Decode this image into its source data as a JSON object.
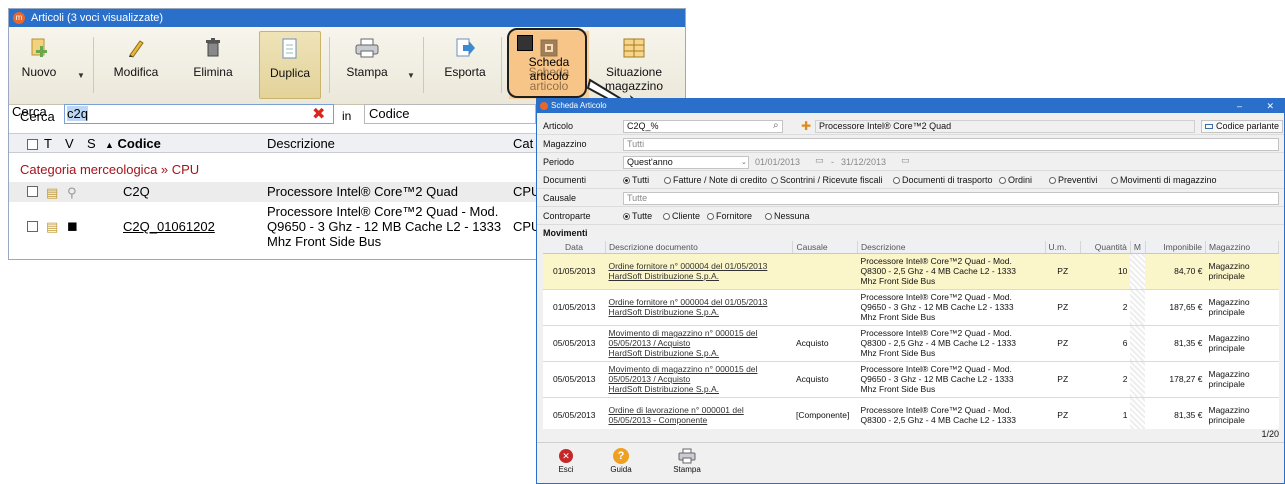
{
  "back_window": {
    "title": "Articoli (3 voci visualizzate)",
    "toolbar": {
      "nuovo": "Nuovo",
      "modifica": "Modifica",
      "elimina": "Elimina",
      "duplica": "Duplica",
      "stampa": "Stampa",
      "esporta": "Esporta",
      "scheda_line1": "Scheda",
      "scheda_line2": "articolo",
      "situazione_line1": "Situazione",
      "situazione_line2": "magazzino"
    },
    "search": {
      "label": "Cerca",
      "value": "c2q",
      "in_label": "in",
      "field": "Codice"
    },
    "columns": [
      "T",
      "V",
      "S",
      "Codice",
      "Descrizione",
      "Cat"
    ],
    "category": "Categoria merceologica » CPU",
    "rows": [
      {
        "codice": "C2Q",
        "descrizione": "Processore Intel® Core™2 Quad",
        "cat": "CPU"
      },
      {
        "codice": "C2Q_01061202",
        "desc1": "Processore Intel® Core™2 Quad - Mod.",
        "desc2": "Q9650 - 3 Ghz - 12 MB Cache L2 - 1333",
        "desc3": "Mhz Front Side Bus",
        "cat": "CPU"
      }
    ]
  },
  "front_window": {
    "title": "Scheda Articolo",
    "articolo_label": "Articolo",
    "articolo_value": "C2Q_%",
    "articolo_desc": "Processore Intel® Core™2 Quad",
    "codice_parlante": "Codice parlante",
    "magazzino_label": "Magazzino",
    "magazzino_value": "Tutti",
    "periodo_label": "Periodo",
    "periodo_value": "Quest'anno",
    "date_from": "01/01/2013",
    "date_sep": "-",
    "date_to": "31/12/2013",
    "documenti_label": "Documenti",
    "documenti_options": [
      "Tutti",
      "Fatture / Note di credito",
      "Scontrini / Ricevute fiscali",
      "Documenti di trasporto",
      "Ordini",
      "Preventivi",
      "Movimenti di magazzino"
    ],
    "causale_label": "Causale",
    "causale_value": "Tutte",
    "controparte_label": "Controparte",
    "controparte_options": [
      "Tutte",
      "Cliente",
      "Fornitore",
      "Nessuna"
    ],
    "movimenti_label": "Movimenti",
    "columns": [
      "Data",
      "Descrizione documento",
      "Causale",
      "Descrizione",
      "U.m.",
      "Quantità",
      "M",
      "Imponibile",
      "Magazzino"
    ],
    "rows": [
      {
        "data": "01/05/2013",
        "doc1": "Ordine fornitore n° 000004 del 01/05/2013",
        "doc2": "HardSoft Distribuzione S.p.A.",
        "doc3": "",
        "causale": "",
        "d1": "Processore Intel® Core™2 Quad - Mod.",
        "d2": "Q8300 - 2,5 Ghz - 4 MB Cache L2 - 1333",
        "d3": "Mhz Front Side Bus",
        "um": "PZ",
        "qta": "10",
        "imp": "84,70 €",
        "mag1": "Magazzino",
        "mag2": "principale"
      },
      {
        "data": "01/05/2013",
        "doc1": "Ordine fornitore n° 000004 del 01/05/2013",
        "doc2": "HardSoft Distribuzione S.p.A.",
        "doc3": "",
        "causale": "",
        "d1": "Processore Intel® Core™2 Quad - Mod.",
        "d2": "Q9650 - 3 Ghz - 12 MB Cache L2 - 1333",
        "d3": "Mhz Front Side Bus",
        "um": "PZ",
        "qta": "2",
        "imp": "187,65 €",
        "mag1": "Magazzino",
        "mag2": "principale"
      },
      {
        "data": "05/05/2013",
        "doc1": "Movimento di magazzino n° 000015 del",
        "doc2": "05/05/2013 / Acquisto",
        "doc3": "HardSoft Distribuzione S.p.A.",
        "causale": "Acquisto",
        "d1": "Processore Intel® Core™2 Quad - Mod.",
        "d2": "Q8300 - 2,5 Ghz - 4 MB Cache L2 - 1333",
        "d3": "Mhz Front Side Bus",
        "um": "PZ",
        "qta": "6",
        "imp": "81,35 €",
        "mag1": "Magazzino",
        "mag2": "principale"
      },
      {
        "data": "05/05/2013",
        "doc1": "Movimento di magazzino n° 000015 del",
        "doc2": "05/05/2013 / Acquisto",
        "doc3": "HardSoft Distribuzione S.p.A.",
        "causale": "Acquisto",
        "d1": "Processore Intel® Core™2 Quad - Mod.",
        "d2": "Q9650 - 3 Ghz - 12 MB Cache L2 - 1333",
        "d3": "Mhz Front Side Bus",
        "um": "PZ",
        "qta": "2",
        "imp": "178,27 €",
        "mag1": "Magazzino",
        "mag2": "principale"
      },
      {
        "data": "05/05/2013",
        "doc1": "Ordine di lavorazione n° 000001 del",
        "doc2": "05/05/2013 - Componente",
        "doc3": "",
        "causale": "[Componente]",
        "d1": "Processore Intel® Core™2 Quad - Mod.",
        "d2": "Q8300 - 2,5 Ghz - 4 MB Cache L2 - 1333",
        "d3": "",
        "um": "PZ",
        "qta": "1",
        "imp": "81,35 €",
        "mag1": "Magazzino",
        "mag2": "principale"
      }
    ],
    "pager": "1/20",
    "buttons": {
      "esci": "Esci",
      "guida": "Guida",
      "stampa": "Stampa"
    }
  },
  "colors": {
    "accent": "#2a6fc9",
    "highlight_border": "#e88a1a",
    "category_text": "#a3141a",
    "row_highlight": "#fbf6c9"
  }
}
